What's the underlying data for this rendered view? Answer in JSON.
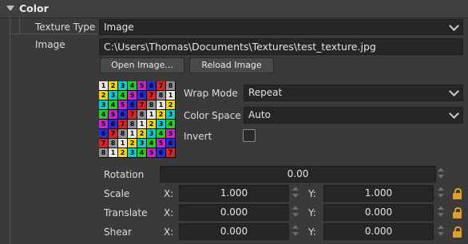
{
  "section": {
    "title": "Color"
  },
  "texture_type": {
    "label": "Texture Type",
    "value": "Image"
  },
  "image": {
    "label": "Image",
    "path": "C:\\Users\\Thomas\\Documents\\Textures\\test_texture.jpg",
    "open_label": "Open Image...",
    "reload_label": "Reload Image"
  },
  "preview": {
    "grid": [
      [
        "1",
        "2",
        "3",
        "4",
        "5",
        "6",
        "7",
        "8"
      ],
      [
        "2",
        "3",
        "4",
        "5",
        "6",
        "7",
        "8",
        "1"
      ],
      [
        "3",
        "4",
        "5",
        "6",
        "7",
        "8",
        "1",
        "2"
      ],
      [
        "4",
        "5",
        "6",
        "7",
        "8",
        "1",
        "2",
        "3"
      ],
      [
        "5",
        "6",
        "7",
        "8",
        "1",
        "2",
        "3",
        "4"
      ],
      [
        "6",
        "7",
        "8",
        "1",
        "2",
        "3",
        "4",
        "5"
      ],
      [
        "7",
        "8",
        "1",
        "2",
        "3",
        "4",
        "5",
        "6"
      ],
      [
        "8",
        "1",
        "2",
        "3",
        "4",
        "5",
        "6",
        "7"
      ]
    ],
    "colors": {
      "1": "#e8e8e8",
      "2": "#f4d800",
      "3": "#00d0d8",
      "4": "#20d020",
      "5": "#d020d0",
      "6": "#2030e0",
      "7": "#e02020",
      "8": "#909090"
    }
  },
  "wrap_mode": {
    "label": "Wrap Mode",
    "value": "Repeat"
  },
  "color_space": {
    "label": "Color Space",
    "value": "Auto"
  },
  "invert": {
    "label": "Invert",
    "checked": false
  },
  "rotation": {
    "label": "Rotation",
    "value": "0.00"
  },
  "scale": {
    "label": "Scale",
    "x_label": "X:",
    "x": "1.000",
    "y_label": "Y:",
    "y": "1.000"
  },
  "translate": {
    "label": "Translate",
    "x_label": "X:",
    "x": "0.000",
    "y_label": "Y:",
    "y": "0.000"
  },
  "shear": {
    "label": "Shear",
    "x_label": "X:",
    "x": "0.000",
    "y_label": "Y:",
    "y": "0.000"
  },
  "icons": {
    "collapse": "triangle-down-icon",
    "dropdown": "chevron-down-icon",
    "lock": "lock-icon",
    "spinner": "spinner-arrows-icon"
  },
  "theme": {
    "accent_lock": "#e0a020",
    "background": "#3a3a3a",
    "field": "#262626"
  }
}
